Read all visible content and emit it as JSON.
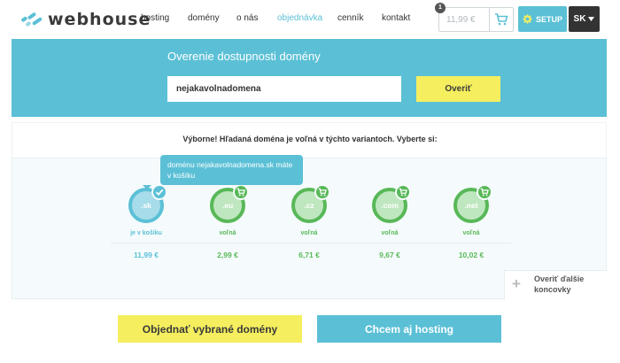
{
  "header": {
    "logo_text": "webhouse",
    "nav": [
      {
        "label": "hosting",
        "active": false
      },
      {
        "label": "domény",
        "active": false
      },
      {
        "label": "o nás",
        "active": false
      },
      {
        "label": "objednávka",
        "active": true
      },
      {
        "label": "cenník",
        "active": false
      },
      {
        "label": "kontakt",
        "active": false
      }
    ],
    "cart": {
      "count": "1",
      "total": "11,99 €"
    },
    "setup_label": "SETUP",
    "language": "SK"
  },
  "search": {
    "title": "Overenie dostupnosti domény",
    "value": "nejakavolnadomena",
    "button_label": "Overiť"
  },
  "results": {
    "message": "Výborne! Hľadaná doména je voľná v týchto variantoch. Vyberte si:",
    "tooltip": "doménu nejakavolnadomena.sk máte v košíku",
    "extensions": [
      {
        "ext": ".sk",
        "status": "je v košíku",
        "price": "11,99 €",
        "selected": true
      },
      {
        "ext": ".eu",
        "status": "voľná",
        "price": "2,99 €",
        "selected": false
      },
      {
        "ext": ".cz",
        "status": "voľná",
        "price": "6,71 €",
        "selected": false
      },
      {
        "ext": ".com",
        "status": "voľná",
        "price": "9,67 €",
        "selected": false
      },
      {
        "ext": ".net",
        "status": "voľná",
        "price": "10,02 €",
        "selected": false
      }
    ],
    "more_label": "Overiť ďalšie koncovky"
  },
  "actions": {
    "order_label": "Objednať vybrané domény",
    "hosting_label": "Chcem aj hosting"
  },
  "colors": {
    "accent": "#5bc0d6",
    "available": "#58b858",
    "button_yellow": "#f5ee5e",
    "dark": "#333333"
  }
}
